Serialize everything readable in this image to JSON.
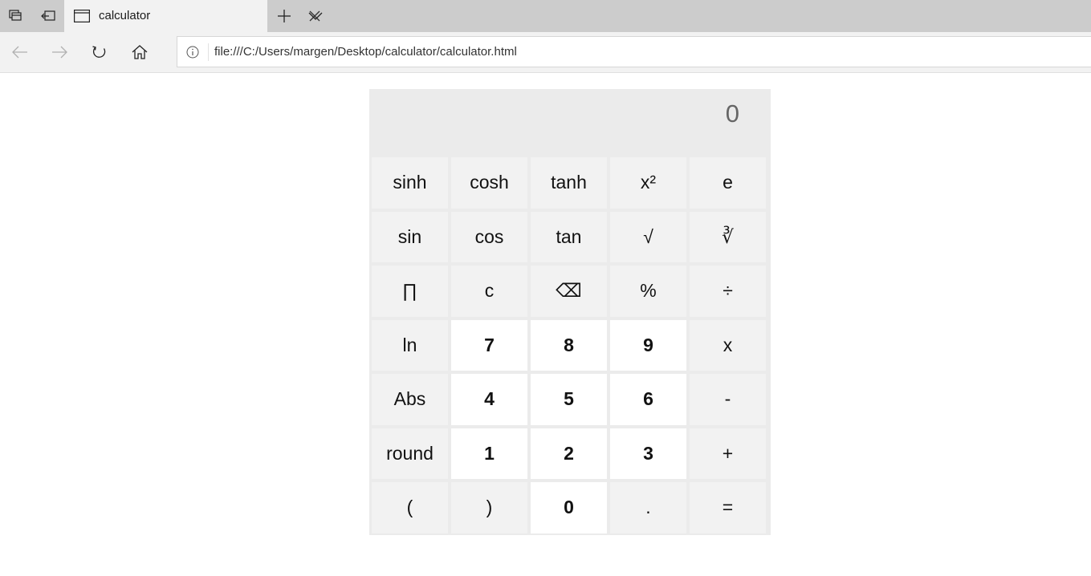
{
  "browser": {
    "tab_title": "calculator",
    "url": "file:///C:/Users/margen/Desktop/calculator/calculator.html"
  },
  "calculator": {
    "display": "0",
    "keys": [
      {
        "label": "sinh",
        "name": "key-sinh",
        "type": "func"
      },
      {
        "label": "cosh",
        "name": "key-cosh",
        "type": "func"
      },
      {
        "label": "tanh",
        "name": "key-tanh",
        "type": "func"
      },
      {
        "label": "x²",
        "name": "key-square",
        "type": "func"
      },
      {
        "label": "e",
        "name": "key-e",
        "type": "func"
      },
      {
        "label": "sin",
        "name": "key-sin",
        "type": "func"
      },
      {
        "label": "cos",
        "name": "key-cos",
        "type": "func"
      },
      {
        "label": "tan",
        "name": "key-tan",
        "type": "func"
      },
      {
        "label": "√",
        "name": "key-sqrt",
        "type": "func"
      },
      {
        "label": "∛",
        "name": "key-cbrt",
        "type": "func"
      },
      {
        "label": "∏",
        "name": "key-pi",
        "type": "func"
      },
      {
        "label": "c",
        "name": "key-clear",
        "type": "func"
      },
      {
        "label": "⌫",
        "name": "key-backspace",
        "type": "func"
      },
      {
        "label": "%",
        "name": "key-percent",
        "type": "func"
      },
      {
        "label": "÷",
        "name": "key-divide",
        "type": "func"
      },
      {
        "label": "ln",
        "name": "key-ln",
        "type": "func"
      },
      {
        "label": "7",
        "name": "key-7",
        "type": "digit"
      },
      {
        "label": "8",
        "name": "key-8",
        "type": "digit"
      },
      {
        "label": "9",
        "name": "key-9",
        "type": "digit"
      },
      {
        "label": "x",
        "name": "key-multiply",
        "type": "func"
      },
      {
        "label": "Abs",
        "name": "key-abs",
        "type": "func"
      },
      {
        "label": "4",
        "name": "key-4",
        "type": "digit"
      },
      {
        "label": "5",
        "name": "key-5",
        "type": "digit"
      },
      {
        "label": "6",
        "name": "key-6",
        "type": "digit"
      },
      {
        "label": "-",
        "name": "key-subtract",
        "type": "func"
      },
      {
        "label": "round",
        "name": "key-round",
        "type": "func"
      },
      {
        "label": "1",
        "name": "key-1",
        "type": "digit"
      },
      {
        "label": "2",
        "name": "key-2",
        "type": "digit"
      },
      {
        "label": "3",
        "name": "key-3",
        "type": "digit"
      },
      {
        "label": "+",
        "name": "key-add",
        "type": "func"
      },
      {
        "label": "(",
        "name": "key-open-paren",
        "type": "func"
      },
      {
        "label": ")",
        "name": "key-close-paren",
        "type": "func"
      },
      {
        "label": "0",
        "name": "key-0",
        "type": "digit"
      },
      {
        "label": ".",
        "name": "key-decimal",
        "type": "func"
      },
      {
        "label": "=",
        "name": "key-equals",
        "type": "func"
      }
    ]
  }
}
